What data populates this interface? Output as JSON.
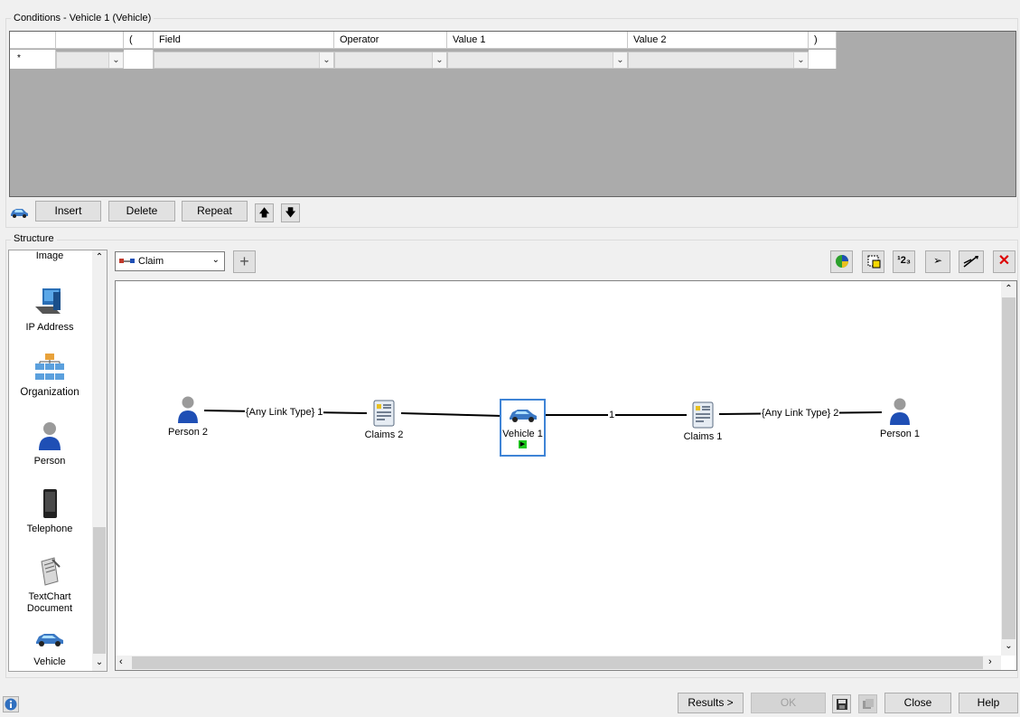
{
  "conditions": {
    "title": "Conditions - Vehicle 1 (Vehicle)",
    "columns": [
      "",
      "",
      "(",
      "Field",
      "Operator",
      "Value 1",
      "Value 2",
      ")"
    ],
    "new_row_marker": "*",
    "buttons": {
      "insert": "Insert",
      "delete": "Delete",
      "repeat": "Repeat"
    }
  },
  "structure": {
    "title": "Structure",
    "palette": [
      "Image",
      "IP Address",
      "Organization",
      "Person",
      "Telephone",
      "TextChart Document",
      "Vehicle"
    ],
    "selected_palette": "Organization",
    "link_type": "Claim",
    "nodes": {
      "person2": "Person 2",
      "claims2": "Claims 2",
      "vehicle1": "Vehicle 1",
      "claims1": "Claims 1",
      "person1": "Person 1"
    },
    "links": {
      "p2_c2": "{Any Link Type} 1",
      "v1_c1": "1",
      "c1_p1": "{Any Link Type} 2"
    }
  },
  "footer": {
    "results": "Results >",
    "ok": "OK",
    "close": "Close",
    "help": "Help"
  }
}
